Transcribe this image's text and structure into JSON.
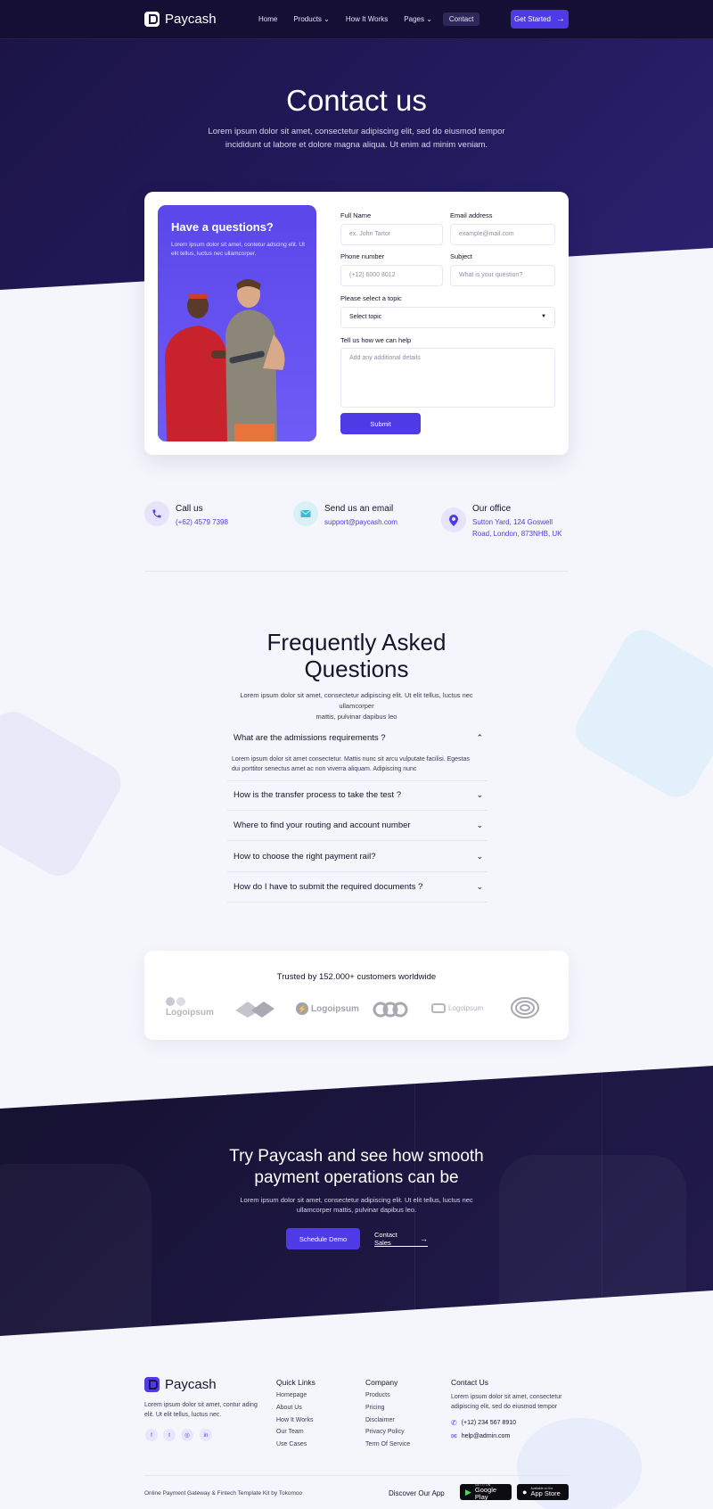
{
  "nav": {
    "brand": "Paycash",
    "links": [
      "Home",
      "Products",
      "How It Works",
      "Pages",
      "Contact"
    ],
    "cta": "Get Started"
  },
  "hero": {
    "title": "Contact us",
    "subtitle": "Lorem ipsum dolor sit amet, consectetur adipiscing elit, sed do eiusmod tempor incididunt ut labore et dolore magna aliqua. Ut enim ad minim veniam."
  },
  "promo": {
    "title": "Have a questions?",
    "text": "Lorem ipsum dolor sit amet, contetur adscing elit. Ut elit tellus, luctus nec ullamcorper."
  },
  "form": {
    "full_name_label": "Full Name",
    "full_name_placeholder": "ex. John Tartor",
    "email_label": "Email address",
    "email_placeholder": "example@mail.com",
    "phone_label": "Phone number",
    "phone_placeholder": "(+12) 6000 8012",
    "subject_label": "Subject",
    "subject_placeholder": "What is your question?",
    "topic_label": "Please select a topic",
    "topic_value": "Select topic",
    "help_label": "Tell us how we can help",
    "help_placeholder": "Add any additional details",
    "submit": "Submit"
  },
  "contact_info": [
    {
      "title": "Call us",
      "value": "(+62) 4579 7398",
      "icon": "phone-icon"
    },
    {
      "title": "Send us an email",
      "value": "support@paycash.com",
      "icon": "mail-icon"
    },
    {
      "title": "Our office",
      "value1": "Sutton Yard, 124 Goswell",
      "value2": "Road, London, 873NHB, UK",
      "icon": "location-icon"
    }
  ],
  "faq": {
    "title1": "Frequently Asked",
    "title2": "Questions",
    "subtitle1": "Lorem ipsum dolor sit amet, consectetur adipiscing elit. Ut elit tellus, luctus nec ullamcorper",
    "subtitle2": "mattis, pulvinar dapibus leo",
    "items": [
      {
        "q": "What are the admissions requirements ?",
        "a1": "Lorem ipsum dolor sit amet consectetur. Mattis nunc sit arcu vulputate facilisi. Egestas",
        "a2": "dui porttitor senectus amet ac non viverra aliquam. Adipiscing nunc"
      },
      {
        "q": "How is the transfer process to take the test ?"
      },
      {
        "q": "Where to find your routing and account number"
      },
      {
        "q": "How to choose the right payment rail?"
      },
      {
        "q": "How do I have to submit the required documents ?"
      }
    ]
  },
  "trust": {
    "title": "Trusted by 152.000+ customers worldwide",
    "logos": [
      "Logoipsum",
      "Logoipsum",
      "Logoipsum"
    ]
  },
  "cta": {
    "title1": "Try Paycash and see how smooth",
    "title2": "payment operations can be",
    "text1": "Lorem ipsum dolor sit amet, consectetur adipiscing elit. Ut elit tellus, luctus nec",
    "text2": "ullamcorper mattis, pulvinar dapibus leo.",
    "demo": "Schedule Demo",
    "sales": "Contact Sales"
  },
  "footer": {
    "brand": "Paycash",
    "about1": "Lorem ipsum dolor sit amet, contur ading",
    "about2": "elit. Ut elit tellus, luctus nec.",
    "quick_title": "Quick Links",
    "quick": [
      "Homepage",
      "About Us",
      "How It Works",
      "Our Team",
      "Use Cases"
    ],
    "company_title": "Company",
    "company": [
      "Products",
      "Pricing",
      "Disclaimer",
      "Privacy Policy",
      "Term Of Service"
    ],
    "contact_title": "Contact Us",
    "contact_text1": "Lorem ipsum dolor sit amet, consectetur",
    "contact_text2": "adipiscing elit, sed do eiusmod tempor",
    "phone": "(+12) 234 567 8910",
    "email": "help@admin.com",
    "credit": "Online Payment Gateway & Fintech Template Kit by Tokomoo",
    "discover": "Discover Our App",
    "google_small": "GET IT ON",
    "google": "Google Play",
    "apple_small": "Available on the",
    "apple": "App Store"
  },
  "colors": {
    "accent": "#4f3be6",
    "dark": "#1b1444",
    "bg": "#f4f6fc"
  }
}
